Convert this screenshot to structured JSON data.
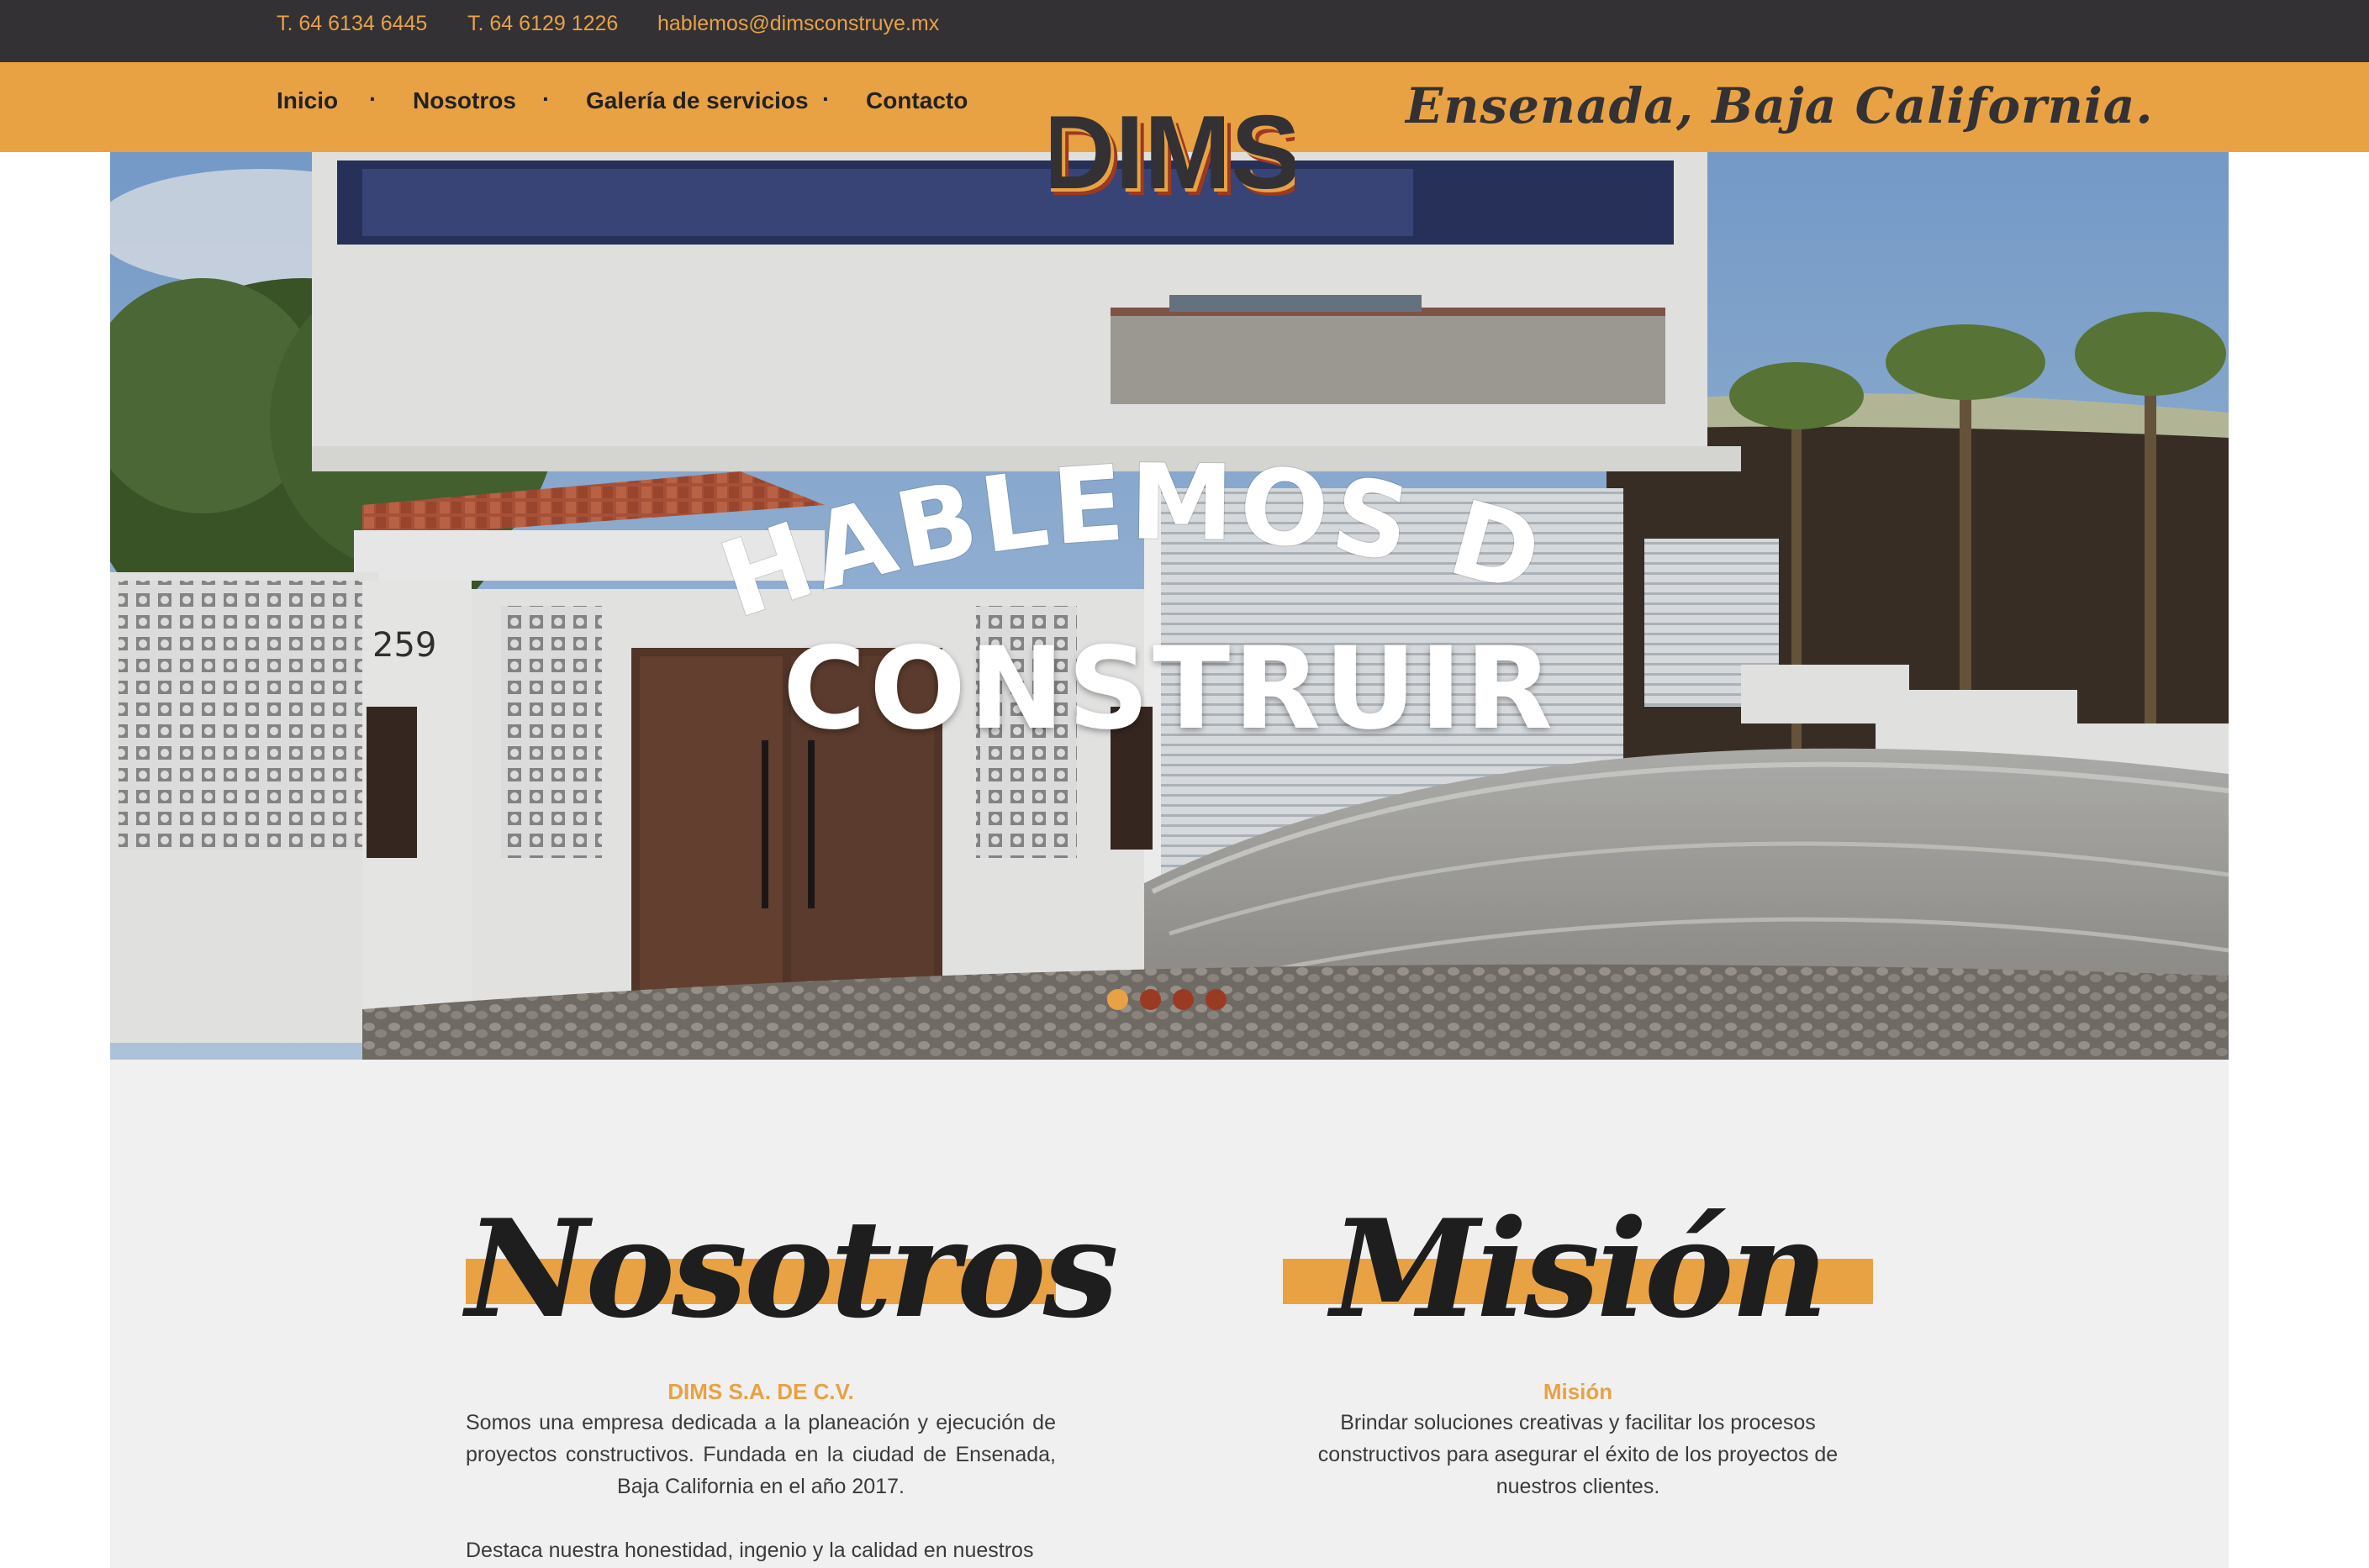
{
  "topbar": {
    "phone1": "T. 64 6134 6445",
    "phone2": "T. 64 6129 1226",
    "email": "hablemos@dimsconstruye.mx"
  },
  "nav": {
    "items": [
      "Inicio",
      "Nosotros",
      "Galería de servicios",
      "Contacto"
    ],
    "separator": "·"
  },
  "tagline": "Ensenada, Baja California.",
  "logo": {
    "text": "DIMS"
  },
  "hero": {
    "line1": "HABLEMOS DE",
    "line2": "CONSTRUIR",
    "house_number": "259",
    "slides": 4,
    "active_slide": 1
  },
  "about": {
    "heading": "Nosotros",
    "subheading": "DIMS S.A. DE C.V.",
    "paragraph1": "Somos una empresa dedicada a la planeación y ejecución de proyectos constructivos. Fundada en la ciudad de Ensenada, Baja California en el año 2017.",
    "paragraph2": "Destaca nuestra honestidad, ingenio y la calidad en nuestros"
  },
  "mission": {
    "heading": "Misión",
    "subheading": "Misión",
    "paragraph": "Brindar soluciones creativas y facilitar los procesos constructivos para asegurar el éxito de los proyectos de nuestros clientes."
  },
  "colors": {
    "accent": "#e8a244",
    "dark": "#333134",
    "dot_inactive": "#9b3a22",
    "section_bg": "#f0f0f0"
  }
}
